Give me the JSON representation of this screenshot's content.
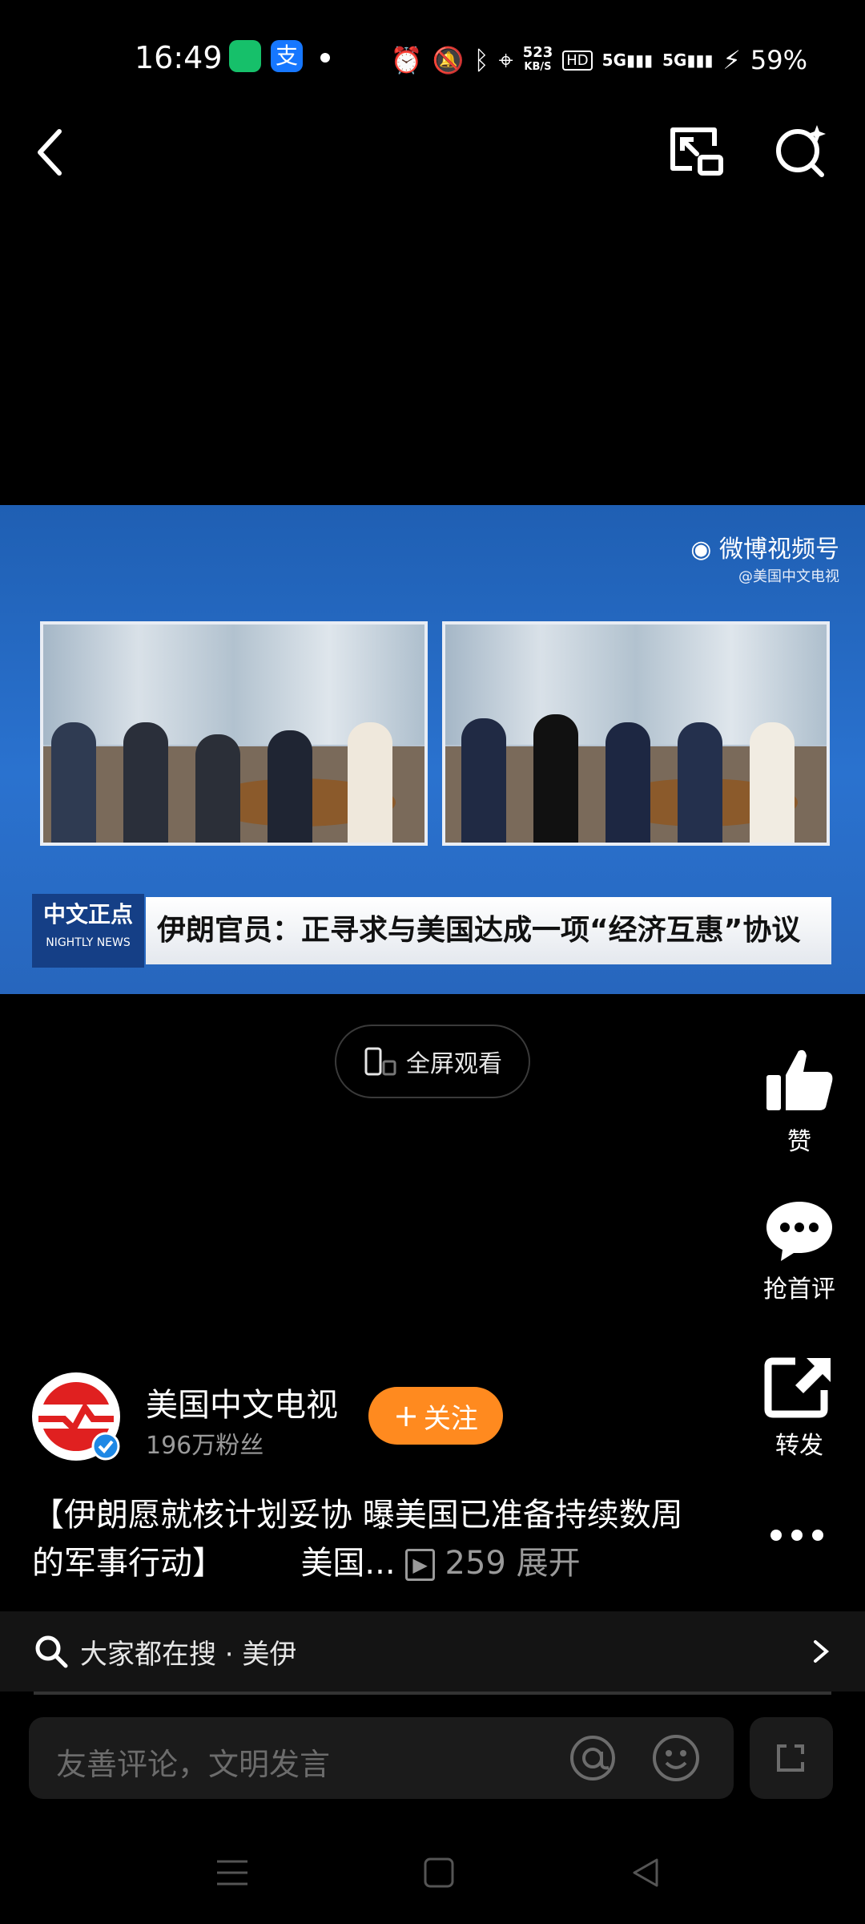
{
  "status": {
    "time": "16:49",
    "net_speed_value": "523",
    "net_speed_unit": "KB/S",
    "hd_label": "HD",
    "signal1": "5G",
    "signal2": "5G",
    "battery": "59%"
  },
  "video": {
    "watermark": "微博视频号",
    "watermark_handle": "@美国中文电视",
    "logo_main": "中文正点",
    "logo_sub": "NIGHTLY NEWS",
    "headline": "伊朗官员：正寻求与美国达成一项“经济互惠”协议"
  },
  "fullscreen_label": "全屏观看",
  "actions": {
    "like": "赞",
    "comment": "抢首评",
    "share": "转发"
  },
  "author": {
    "name": "美国中文电视",
    "fans": "196万粉丝",
    "follow_label": "关注"
  },
  "description": {
    "text": "【伊朗愿就核计划妥协 曝美国已准备持续数周的军事行动】",
    "tail": "美国...",
    "views": "259",
    "expand": "展开"
  },
  "search_strip": {
    "text": "大家都在搜 · 美伊"
  },
  "comment": {
    "placeholder": "友善评论，文明发言"
  },
  "colors": {
    "accent": "#ff8a1f",
    "video_bg": "#2a72cf"
  }
}
